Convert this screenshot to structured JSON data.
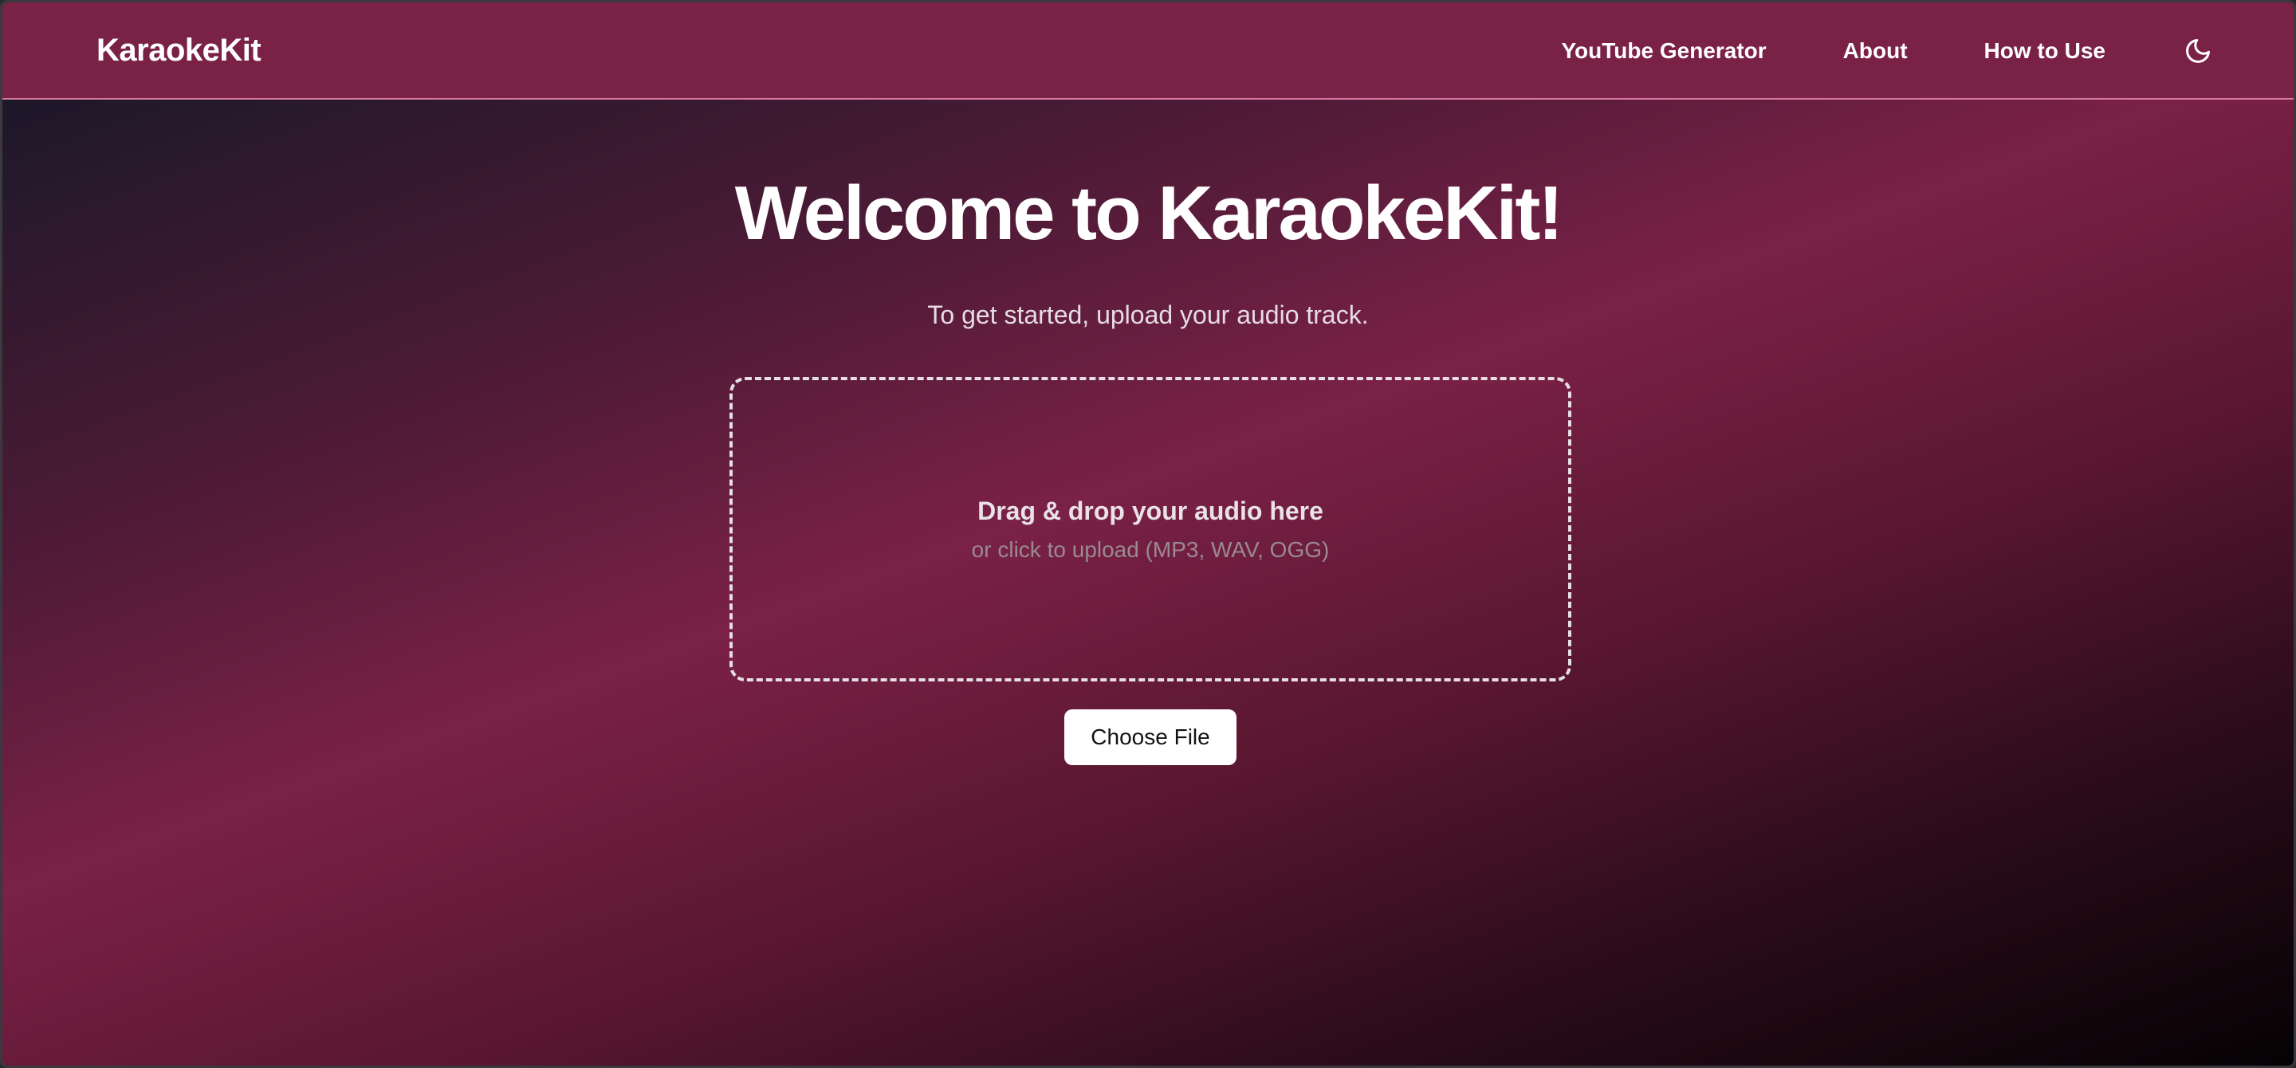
{
  "app": {
    "brand": "KaraokeKit"
  },
  "nav": {
    "items": [
      {
        "label": "YouTube Generator"
      },
      {
        "label": "About"
      },
      {
        "label": "How to Use"
      }
    ],
    "theme_toggle_icon": "moon-icon"
  },
  "hero": {
    "title": "Welcome to KaraokeKit!",
    "subtitle": "To get started, upload your audio track."
  },
  "dropzone": {
    "title": "Drag & drop your audio here",
    "hint": "or click to upload (MP3, WAV, OGG)"
  },
  "upload": {
    "button_label": "Choose File"
  },
  "colors": {
    "navbar": "#7a2146",
    "accent": "#d87aa2",
    "button_bg": "#ffffff"
  }
}
